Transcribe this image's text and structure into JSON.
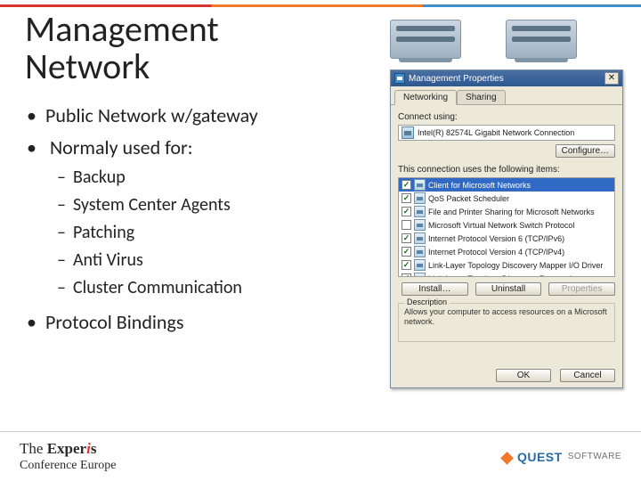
{
  "title_line1": "Management",
  "title_line2": "Network",
  "bullets": {
    "item1": "Public Network w/gateway",
    "item2": "Normaly used for:",
    "sub": {
      "s1": "Backup",
      "s2": "System Center Agents",
      "s3": "Patching",
      "s4": "Anti Virus",
      "s5": "Cluster Communication"
    },
    "item3": "Protocol Bindings"
  },
  "dialog": {
    "title": "Management Properties",
    "close_glyph": "✕",
    "tabs": {
      "networking": "Networking",
      "sharing": "Sharing"
    },
    "connect_using_label": "Connect using:",
    "adapter": "Intel(R) 82574L Gigabit Network Connection",
    "configure_btn": "Configure…",
    "items_label": "This connection uses the following items:",
    "items": [
      {
        "checked": true,
        "label": "Client for Microsoft Networks",
        "selected": true
      },
      {
        "checked": true,
        "label": "QoS Packet Scheduler",
        "selected": false
      },
      {
        "checked": true,
        "label": "File and Printer Sharing for Microsoft Networks",
        "selected": false
      },
      {
        "checked": false,
        "label": "Microsoft Virtual Network Switch Protocol",
        "selected": false
      },
      {
        "checked": true,
        "label": "Internet Protocol Version 6 (TCP/IPv6)",
        "selected": false
      },
      {
        "checked": true,
        "label": "Internet Protocol Version 4 (TCP/IPv4)",
        "selected": false
      },
      {
        "checked": true,
        "label": "Link-Layer Topology Discovery Mapper I/O Driver",
        "selected": false
      },
      {
        "checked": true,
        "label": "Link-Layer Topology Discovery Responder",
        "selected": false
      }
    ],
    "install_btn": "Install…",
    "uninstall_btn": "Uninstall",
    "properties_btn": "Properties",
    "description_label": "Description",
    "description_text": "Allows your computer to access resources on a Microsoft network.",
    "ok_btn": "OK",
    "cancel_btn": "Cancel"
  },
  "footer": {
    "experis_line1_a": "The ",
    "experis_line1_b": "Exper",
    "experis_line1_c": "i",
    "experis_line1_d": "s",
    "experis_line2": "Conference Europe",
    "quest_name": "QUEST",
    "quest_soft": "SOFTWARE"
  }
}
